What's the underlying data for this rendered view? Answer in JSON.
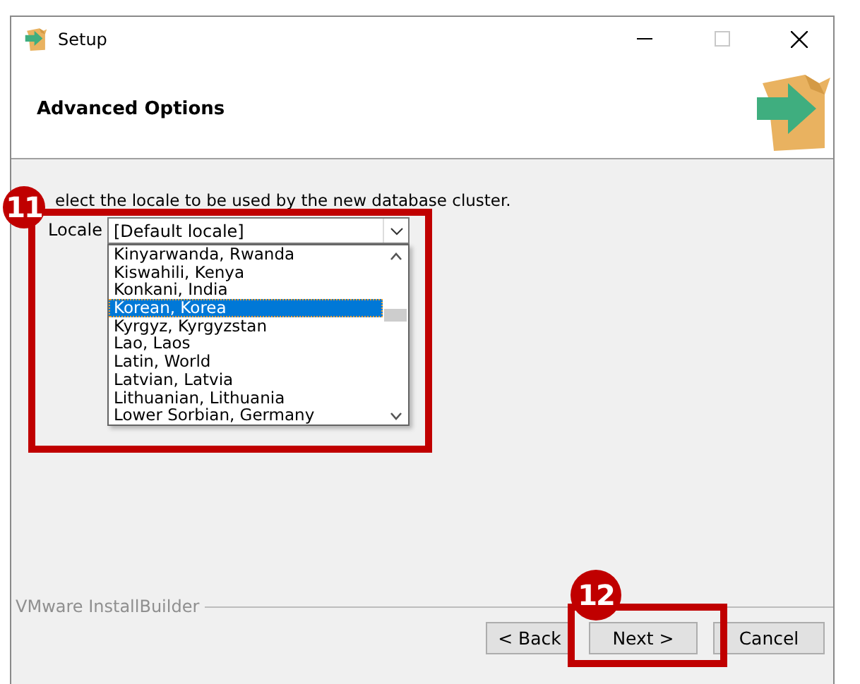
{
  "window": {
    "title": "Setup"
  },
  "header": {
    "title": "Advanced Options"
  },
  "instruction": "elect the locale to be used by the new database cluster.",
  "locale": {
    "label": "Locale",
    "value": "[Default locale]",
    "expanded": true,
    "options": [
      {
        "label": "Kinyarwanda, Rwanda",
        "selected": false
      },
      {
        "label": "Kiswahili, Kenya",
        "selected": false
      },
      {
        "label": "Konkani, India",
        "selected": false
      },
      {
        "label": "Korean, Korea",
        "selected": true
      },
      {
        "label": "Kyrgyz, Kyrgyzstan",
        "selected": false
      },
      {
        "label": "Lao, Laos",
        "selected": false
      },
      {
        "label": "Latin, World",
        "selected": false
      },
      {
        "label": "Latvian, Latvia",
        "selected": false
      },
      {
        "label": "Lithuanian, Lithuania",
        "selected": false
      },
      {
        "label": "Lower Sorbian, Germany",
        "selected": false
      }
    ]
  },
  "footer": {
    "brand": "VMware InstallBuilder"
  },
  "buttons": [
    {
      "label": "< Back"
    },
    {
      "label": "Next >"
    },
    {
      "label": "Cancel"
    }
  ],
  "annotations": [
    {
      "number": "11"
    },
    {
      "number": "12"
    }
  ]
}
